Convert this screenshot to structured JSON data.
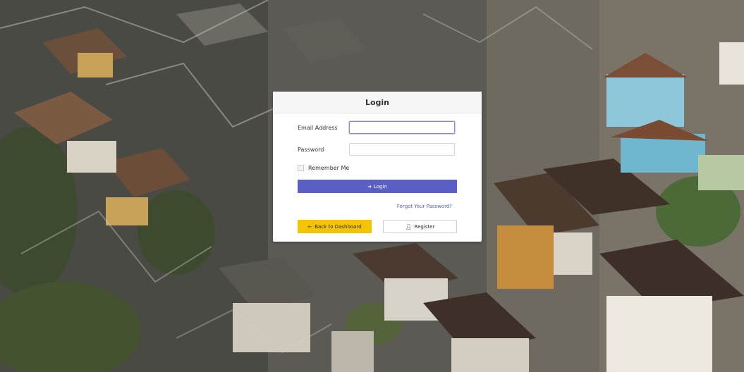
{
  "form": {
    "title": "Login",
    "email_label": "Email Address",
    "email_value": "",
    "password_label": "Password",
    "password_value": "",
    "remember_label": "Remember Me",
    "login_label": "Login",
    "login_icon": "sign-in-icon",
    "forgot_label": "Forgot Your Password?",
    "back_label": "Back to Dashboard",
    "back_icon": "arrow-left-icon",
    "register_label": "Register",
    "register_icon": "user-plus-icon"
  },
  "colors": {
    "primary": "#5a5ec5",
    "warning": "#f5c400",
    "link": "#4f61c4",
    "focus_border": "#8a8ad8"
  },
  "background": {
    "image": "aerial-houses-photo"
  }
}
